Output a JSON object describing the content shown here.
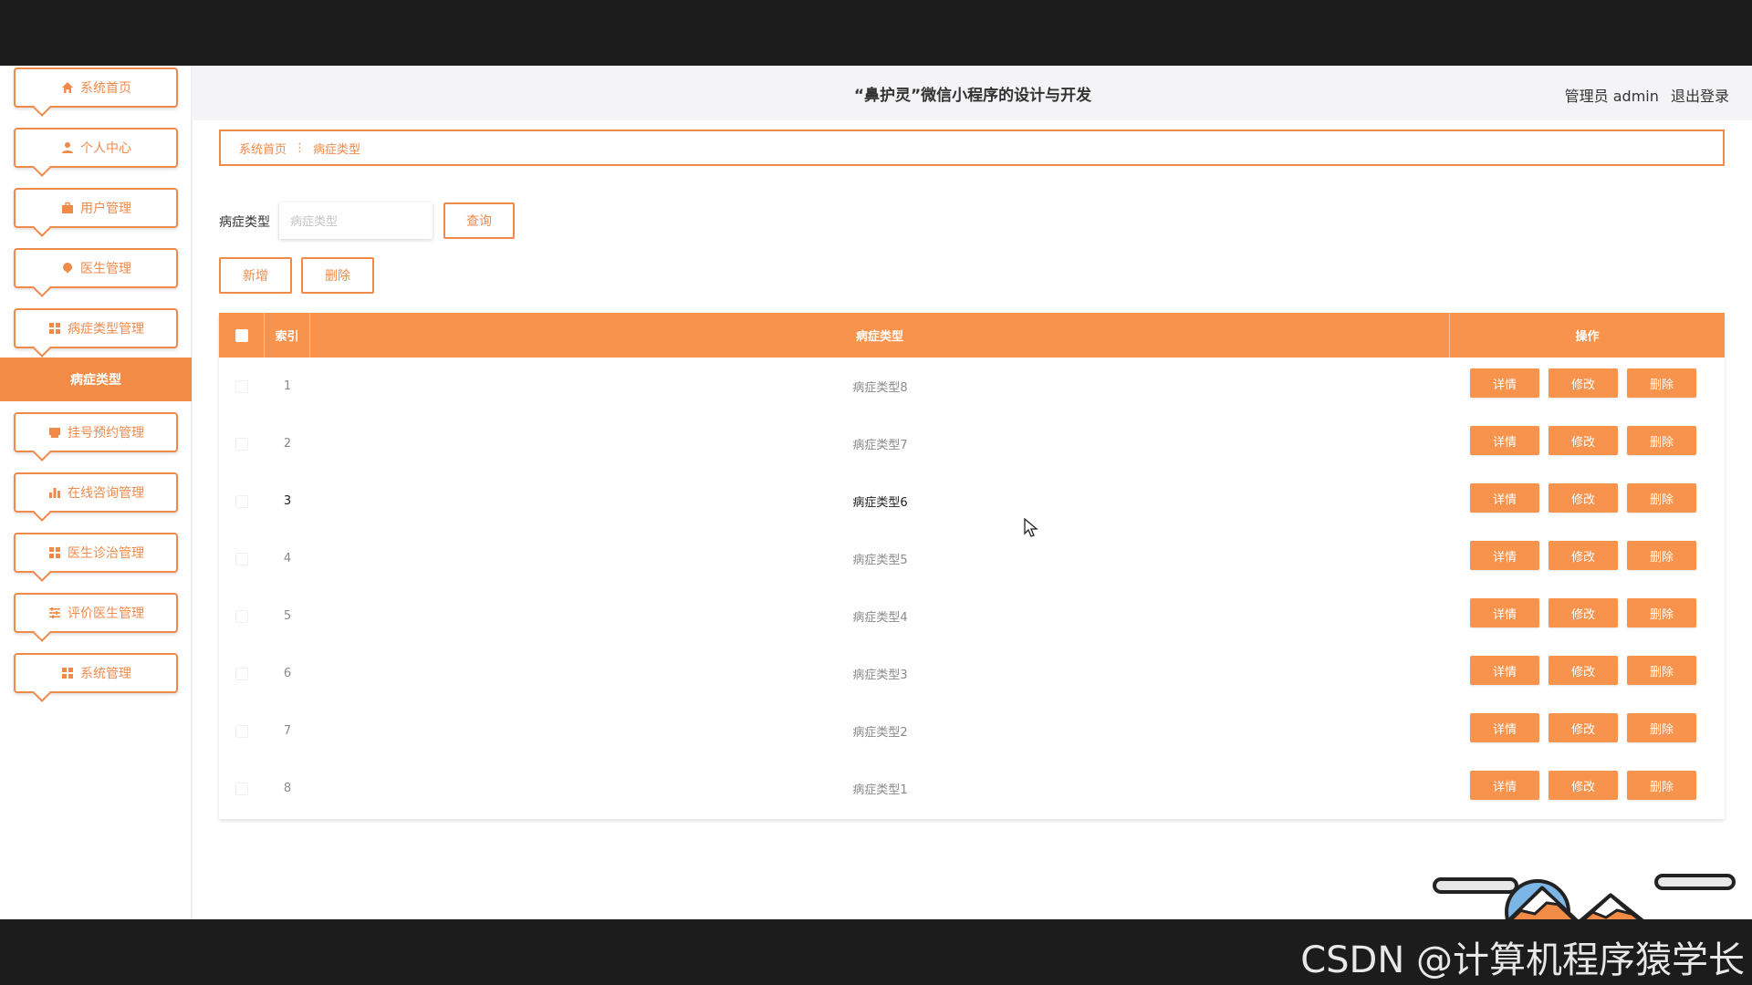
{
  "header": {
    "title": "“鼻护灵”微信小程序的设计与开发",
    "user": "管理员 admin",
    "logout": "退出登录"
  },
  "sidebar": {
    "items": [
      {
        "label": "系统首页",
        "icon": "home-icon"
      },
      {
        "label": "个人中心",
        "icon": "user-icon"
      },
      {
        "label": "用户管理",
        "icon": "briefcase-icon"
      },
      {
        "label": "医生管理",
        "icon": "pin-icon"
      },
      {
        "label": "病症类型管理",
        "icon": "grid-icon"
      },
      {
        "label": "挂号预约管理",
        "icon": "calendar-icon"
      },
      {
        "label": "在线咨询管理",
        "icon": "bar-chart-icon"
      },
      {
        "label": "医生诊治管理",
        "icon": "grid-icon"
      },
      {
        "label": "评价医生管理",
        "icon": "sliders-icon"
      },
      {
        "label": "系统管理",
        "icon": "grid-icon"
      }
    ],
    "active_sub": "病症类型"
  },
  "breadcrumb": {
    "home": "系统首页",
    "separator": "⋮",
    "current": "病症类型"
  },
  "search": {
    "label": "病症类型",
    "placeholder": "病症类型",
    "query_button": "查询"
  },
  "toolbar": {
    "add": "新增",
    "delete": "删除"
  },
  "table": {
    "headers": {
      "index": "索引",
      "type": "病症类型",
      "actions": "操作"
    },
    "actions": {
      "detail": "详情",
      "edit": "修改",
      "delete": "删除"
    },
    "rows": [
      {
        "index": "1",
        "type": "病症类型8"
      },
      {
        "index": "2",
        "type": "病症类型7"
      },
      {
        "index": "3",
        "type": "病症类型6"
      },
      {
        "index": "4",
        "type": "病症类型5"
      },
      {
        "index": "5",
        "type": "病症类型4"
      },
      {
        "index": "6",
        "type": "病症类型3"
      },
      {
        "index": "7",
        "type": "病症类型2"
      },
      {
        "index": "8",
        "type": "病症类型1"
      }
    ],
    "highlighted_row": 3
  },
  "watermark": "CSDN @计算机程序猿学长",
  "colors": {
    "accent": "#f7934c",
    "border": "#f08a4b",
    "dark": "#1c1c1c"
  }
}
